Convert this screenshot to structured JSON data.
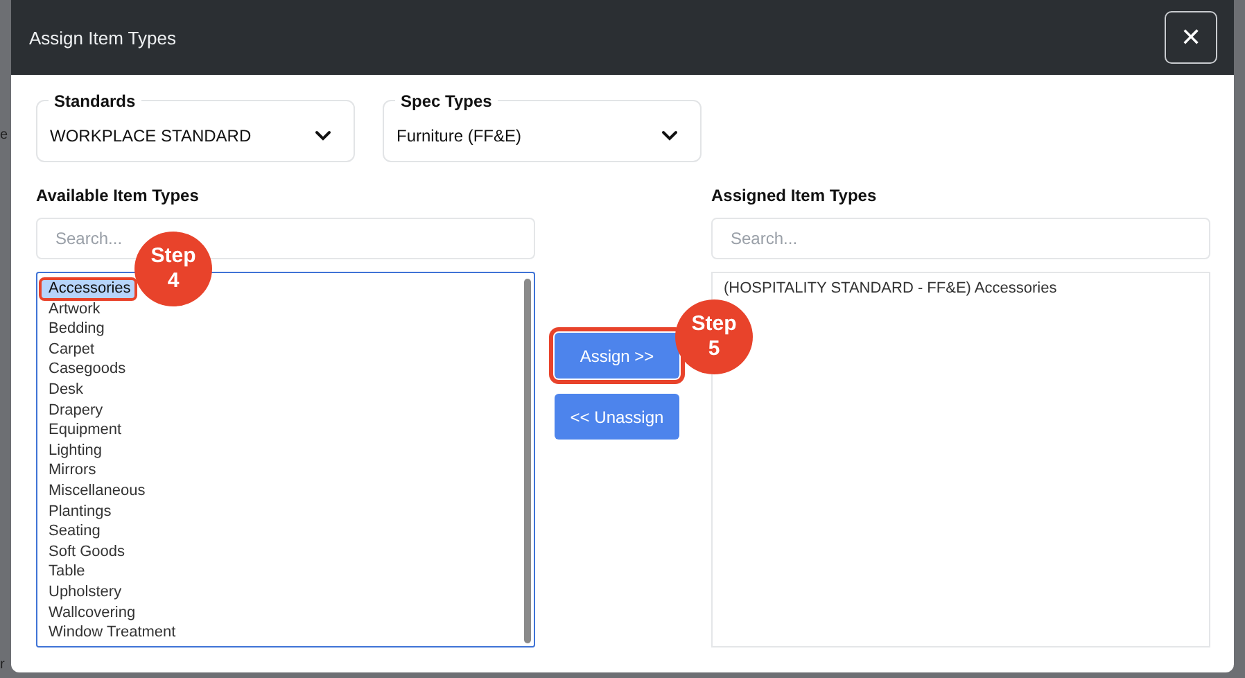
{
  "background_fragments": [
    "e",
    "r"
  ],
  "dialog": {
    "title": "Assign Item Types",
    "close_label": "✕"
  },
  "filters": [
    {
      "label": "Standards",
      "value": "WORKPLACE STANDARD"
    },
    {
      "label": "Spec Types",
      "value": "Furniture (FF&E)"
    }
  ],
  "available": {
    "title": "Available Item Types",
    "search": {
      "placeholder": "Search..."
    },
    "items": [
      {
        "label": "Accessories",
        "selected": true,
        "highlighted": true
      },
      {
        "label": "Artwork",
        "selected": false,
        "highlighted": false
      },
      {
        "label": "Bedding",
        "selected": false,
        "highlighted": false
      },
      {
        "label": "Carpet",
        "selected": false,
        "highlighted": false
      },
      {
        "label": "Casegoods",
        "selected": false,
        "highlighted": false
      },
      {
        "label": "Desk",
        "selected": false,
        "highlighted": false
      },
      {
        "label": "Drapery",
        "selected": false,
        "highlighted": false
      },
      {
        "label": "Equipment",
        "selected": false,
        "highlighted": false
      },
      {
        "label": "Lighting",
        "selected": false,
        "highlighted": false
      },
      {
        "label": "Mirrors",
        "selected": false,
        "highlighted": false
      },
      {
        "label": "Miscellaneous",
        "selected": false,
        "highlighted": false
      },
      {
        "label": "Plantings",
        "selected": false,
        "highlighted": false
      },
      {
        "label": "Seating",
        "selected": false,
        "highlighted": false
      },
      {
        "label": "Soft Goods",
        "selected": false,
        "highlighted": false
      },
      {
        "label": "Table",
        "selected": false,
        "highlighted": false
      },
      {
        "label": "Upholstery",
        "selected": false,
        "highlighted": false
      },
      {
        "label": "Wallcovering",
        "selected": false,
        "highlighted": false
      },
      {
        "label": "Window Treatment",
        "selected": false,
        "highlighted": false
      }
    ]
  },
  "actions": [
    {
      "label": "Assign >>",
      "highlighted": true
    },
    {
      "label": "<< Unassign",
      "highlighted": false
    }
  ],
  "assigned": {
    "title": "Assigned Item Types",
    "search": {
      "placeholder": "Search..."
    },
    "items": [
      {
        "label": "(HOSPITALITY STANDARD - FF&E) Accessories",
        "selected": false,
        "highlighted": false
      }
    ]
  },
  "step_badges": [
    {
      "label": "Step",
      "number": "4"
    },
    {
      "label": "Step",
      "number": "5"
    }
  ]
}
